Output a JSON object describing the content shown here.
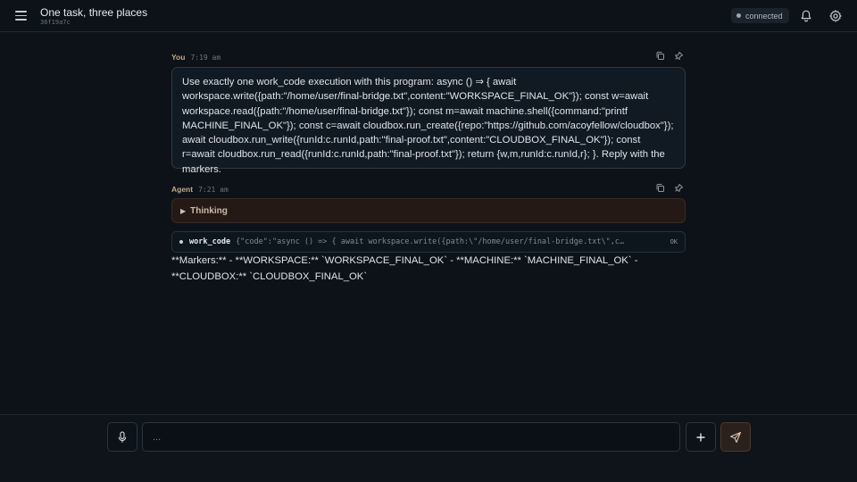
{
  "header": {
    "title": "One task, three places",
    "id": "36f19a7c",
    "status": "connected",
    "colors": {
      "background": "#0c1218",
      "status_dot": "#9aa6b2"
    }
  },
  "messages": [
    {
      "role": "You",
      "time": "7:19 am",
      "text": "Use exactly one work_code execution with this program: async () ⇒ { await workspace.write({path:\"/home/user/final-bridge.txt\",content:\"WORKSPACE_FINAL_OK\"}); const w=await workspace.read({path:\"/home/user/final-bridge.txt\"}); const m=await machine.shell({command:\"printf MACHINE_FINAL_OK\"}); const c=await cloudbox.run_create({repo:\"https://github.com/acoyfellow/cloudbox\"}); await cloudbox.run_write({runId:c.runId,path:\"final-proof.txt\",content:\"CLOUDBOX_FINAL_OK\"}); const r=await cloudbox.run_read({runId:c.runId,path:\"final-proof.txt\"}); return {w,m,runId:c.runId,r}; }. Reply with the markers."
    },
    {
      "role": "Agent",
      "time": "7:21 am",
      "thinking_label": "Thinking",
      "tool_call": {
        "name": "work_code",
        "args": "{\"code\":\"async () => { await workspace.write({path:\\\"/home/user/final-bridge.txt\\\",content:\\\"WORKSPACE_FINAL_OK\\\"}); const w=await workspace.read({path:\\\"/home/user/final-bridge.txt\\\"});",
        "status": "OK"
      },
      "text": "**Markers:** - **WORKSPACE:** `WORKSPACE_FINAL_OK` - **MACHINE:** `MACHINE_FINAL_OK` - **CLOUDBOX:** `CLOUDBOX_FINAL_OK`"
    }
  ],
  "composer": {
    "placeholder": "..."
  },
  "icons": {
    "menu": "menu-icon",
    "notifications": "bell-icon",
    "settings": "gear-icon",
    "copy": "copy-icon",
    "pin": "pin-icon",
    "mic": "microphone-icon",
    "add": "plus-icon",
    "send": "send-icon"
  }
}
